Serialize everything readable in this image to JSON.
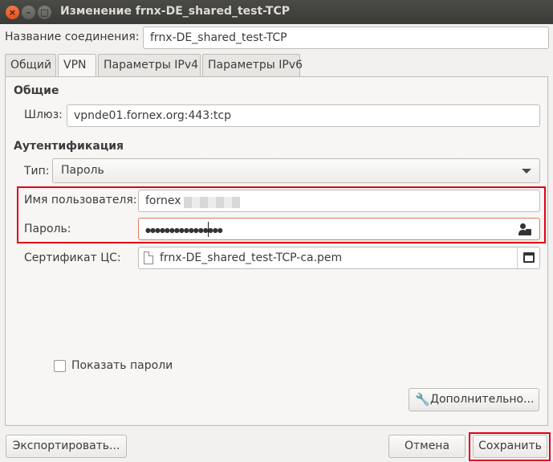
{
  "window": {
    "title": "Изменение frnx-DE_shared_test-TCP",
    "close_glyph": "×",
    "minimize_glyph": "–",
    "maximize_glyph": "□"
  },
  "connection": {
    "name_label": "Название соединения:",
    "name_value": "frnx-DE_shared_test-TCP"
  },
  "tabs": [
    {
      "label": "Общий",
      "active": false
    },
    {
      "label": "VPN",
      "active": true
    },
    {
      "label": "Параметры IPv4",
      "active": false
    },
    {
      "label": "Параметры IPv6",
      "active": false
    }
  ],
  "general": {
    "heading": "Общие",
    "gateway_label": "Шлюз:",
    "gateway_value": "vpnde01.fornex.org:443:tcp"
  },
  "auth": {
    "heading": "Аутентификация",
    "type_label": "Тип:",
    "type_value": "Пароль",
    "username_label": "Имя пользователя:",
    "username_value": "fornex",
    "password_label": "Пароль:",
    "password_value": "●●●●●●●●●●●●●●●●",
    "password_icon": "user-lock-icon",
    "ca_label": "Сертификат ЦС:",
    "ca_value": "frnx-DE_shared_test-TCP-ca.pem"
  },
  "show_passwords": {
    "label": "Показать пароли",
    "checked": false
  },
  "buttons": {
    "advanced": "Дополнительно...",
    "export": "Экспортировать...",
    "cancel": "Отмена",
    "save": "Сохранить"
  },
  "colors": {
    "highlight": "#e0001b",
    "titlebar": "#3c3b37",
    "close_button": "#e95420"
  }
}
